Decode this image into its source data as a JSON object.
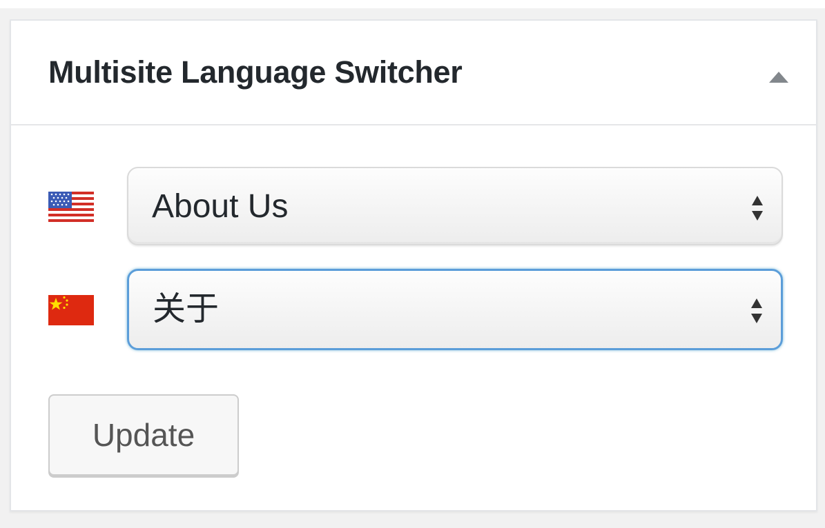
{
  "colors": {
    "panel_background": "#ffffff",
    "page_background": "#f1f1f1",
    "focus_border": "#5b9dd9",
    "title_text": "#23282d"
  },
  "postbox": {
    "title": "Multisite Language Switcher",
    "toggle_icon": "triangle-up-icon"
  },
  "languages": [
    {
      "flag_icon": "us-flag-icon",
      "selected": "About Us",
      "focused": false
    },
    {
      "flag_icon": "china-flag-icon",
      "selected": "关于",
      "focused": true
    }
  ],
  "actions": {
    "update_label": "Update"
  }
}
